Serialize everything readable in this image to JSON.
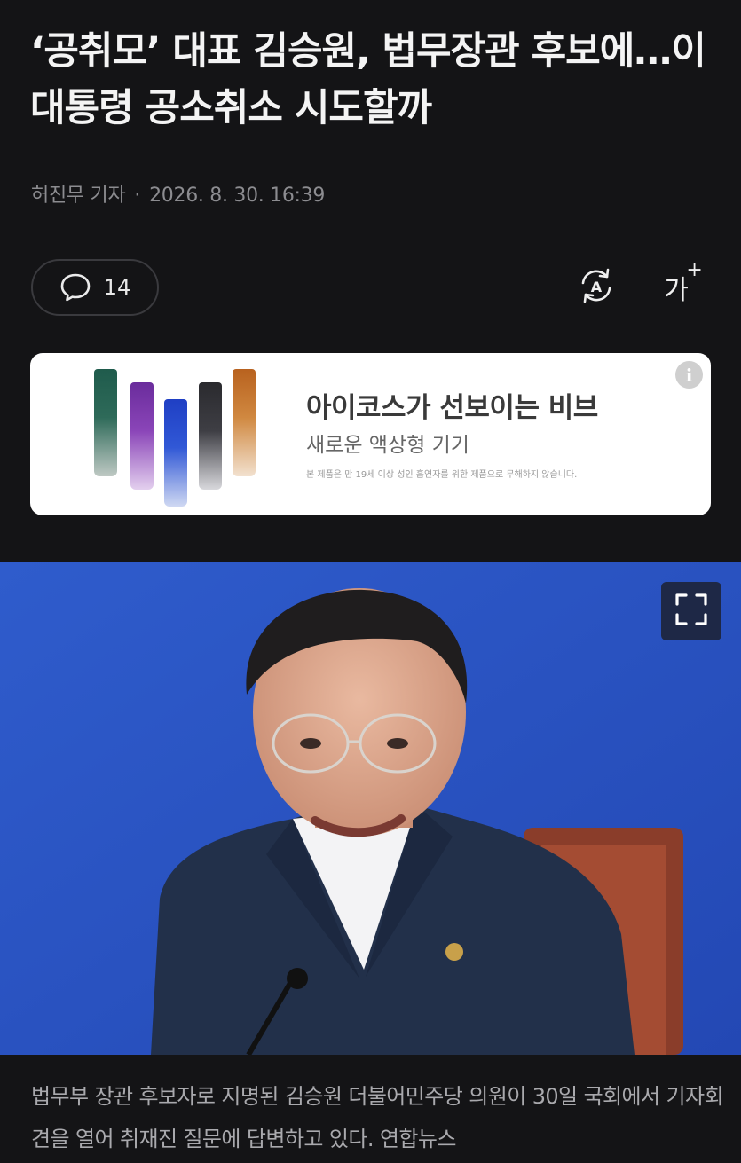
{
  "article": {
    "headline": "‘공취모’ 대표 김승원, 법무장관 후보에…이 대통령 공소취소 시도할까",
    "reporter": "허진무 기자",
    "separator": "·",
    "datetime": "2026. 8. 30. 16:39",
    "caption": "법무부 장관 후보자로 지명된 김승원 더불어민주당 의원이 30일 국회에서 기자회견을 열어 취재진 질문에 답변하고 있다. 연합뉴스"
  },
  "toolbar": {
    "comment_count": "14",
    "auto_read_icon": "auto-read-icon",
    "font_size_label": "가",
    "font_size_plus": "+"
  },
  "ad": {
    "title": "아이코스가 선보이는 비브",
    "subtitle": "새로운 액상형 기기",
    "disclaimer": "본 제품은 만 19세 이상 성인 흡연자를 위한 제품으로 무해하지 않습니다.",
    "info_icon": "i",
    "product_colors": [
      "#1f5b4c",
      "#7b3aa8",
      "#2d4fcf",
      "#3a3a3e",
      "#c9752f"
    ]
  },
  "photo": {
    "expand_icon": "expand-icon",
    "background_color": "#2b56c6"
  },
  "colors": {
    "page_bg": "#141416",
    "headline": "#f4f4f4",
    "meta": "#8c8c90",
    "caption": "#a9a9ad"
  }
}
